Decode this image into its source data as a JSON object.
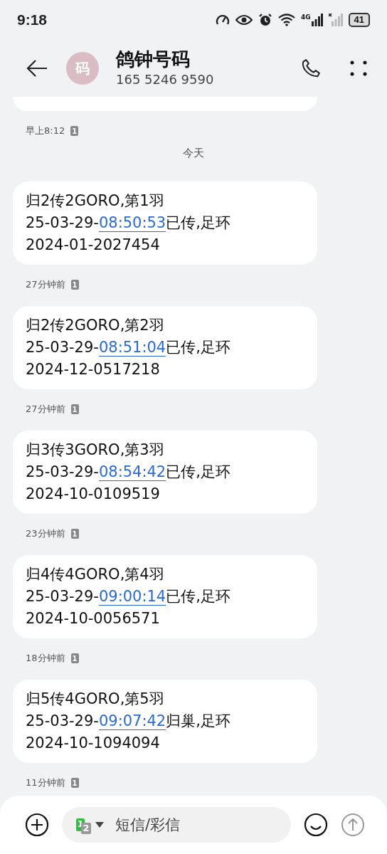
{
  "status_bar": {
    "time": "9:18",
    "battery": "41",
    "network": "4G"
  },
  "header": {
    "avatar": "码",
    "name": "鸽钟号码",
    "number": "165 5246 9590"
  },
  "earlier": {
    "time": "早上8:12",
    "sim": "1"
  },
  "date_divider": "今天",
  "messages": [
    {
      "line1": "归2传2GORO,第1羽",
      "date_prefix": "25-03-29-",
      "time_link": "08:50:53",
      "suffix": "已传,足环",
      "line3": "2024-01-2027454",
      "time": "27分钟前",
      "sim": "1"
    },
    {
      "line1": "归2传2GORO,第2羽",
      "date_prefix": "25-03-29-",
      "time_link": "08:51:04",
      "suffix": "已传,足环",
      "line3": "2024-12-0517218",
      "time": "27分钟前",
      "sim": "1"
    },
    {
      "line1": "归3传3GORO,第3羽",
      "date_prefix": "25-03-29-",
      "time_link": "08:54:42",
      "suffix": "已传,足环",
      "line3": "2024-10-0109519",
      "time": "23分钟前",
      "sim": "1"
    },
    {
      "line1": "归4传4GORO,第4羽",
      "date_prefix": "25-03-29-",
      "time_link": "09:00:14",
      "suffix": "已传,足环",
      "line3": "2024-10-0056571",
      "time": "18分钟前",
      "sim": "1"
    },
    {
      "line1": "归5传4GORO,第5羽",
      "date_prefix": "25-03-29-",
      "time_link": "09:07:42",
      "suffix": "归巢,足环",
      "line3": "2024-10-1094094",
      "time": "11分钟前",
      "sim": "1"
    }
  ],
  "composer": {
    "sim_primary": "1",
    "sim_secondary": "2",
    "placeholder": "短信/彩信"
  }
}
